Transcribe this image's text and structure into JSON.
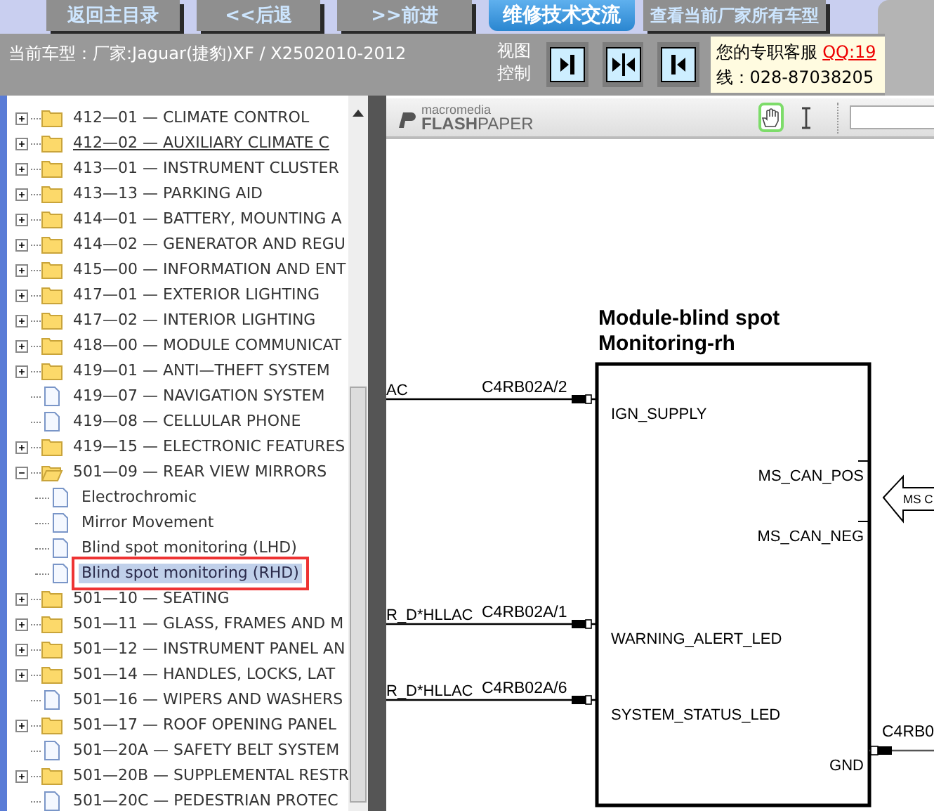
{
  "top_nav": {
    "buttons": [
      {
        "label": "返回主目录",
        "kind": "gray"
      },
      {
        "label": "<<后退",
        "kind": "gray"
      },
      {
        "label": ">>前进",
        "kind": "gray"
      },
      {
        "label": "维修技术交流",
        "kind": "blue"
      },
      {
        "label": "查看当前厂家所有车型",
        "kind": "gray"
      }
    ]
  },
  "model_bar": {
    "current_model": "当前车型：厂家:Jaguar(捷豹)XF / X2502010-2012",
    "view_control_label": "视图控制",
    "view_buttons": [
      {
        "kind": "expand-right"
      },
      {
        "kind": "split"
      },
      {
        "kind": "expand-left"
      }
    ],
    "support": {
      "label": "您的专职客服",
      "qq": "QQ:19",
      "phone": "线：028-87038205"
    }
  },
  "tree": {
    "items": [
      {
        "label": "412—01 — CLIMATE CONTROL",
        "kind": "folder",
        "expanded": false,
        "hovered": false
      },
      {
        "label": "412—02 — AUXILIARY CLIMATE C",
        "kind": "folder",
        "expanded": false,
        "hovered": true
      },
      {
        "label": "413—01 — INSTRUMENT CLUSTER",
        "kind": "folder",
        "expanded": false,
        "hovered": false
      },
      {
        "label": "413—13 — PARKING AID",
        "kind": "folder",
        "expanded": false,
        "hovered": false
      },
      {
        "label": "414—01 — BATTERY, MOUNTING A",
        "kind": "folder",
        "expanded": false,
        "hovered": false
      },
      {
        "label": "414—02 — GENERATOR AND REGU",
        "kind": "folder",
        "expanded": false,
        "hovered": false
      },
      {
        "label": "415—00 — INFORMATION AND ENT",
        "kind": "folder",
        "expanded": false,
        "hovered": false
      },
      {
        "label": "417—01 — EXTERIOR LIGHTING",
        "kind": "folder",
        "expanded": false,
        "hovered": false
      },
      {
        "label": "417—02 — INTERIOR LIGHTING",
        "kind": "folder",
        "expanded": false,
        "hovered": false
      },
      {
        "label": "418—00 — MODULE COMMUNICAT",
        "kind": "folder",
        "expanded": false,
        "hovered": false
      },
      {
        "label": "419—01 — ANTI—THEFT SYSTEM",
        "kind": "folder",
        "expanded": false,
        "hovered": false
      },
      {
        "label": "419—07 — NAVIGATION SYSTEM",
        "kind": "document",
        "hovered": false
      },
      {
        "label": "419—08 — CELLULAR PHONE",
        "kind": "document",
        "hovered": false
      },
      {
        "label": "419—15 — ELECTRONIC FEATURES",
        "kind": "folder",
        "expanded": false,
        "hovered": false
      },
      {
        "label": "501—09 — REAR VIEW MIRRORS",
        "kind": "folder",
        "expanded": true,
        "hovered": false,
        "children": [
          {
            "label": "Electrochromic",
            "kind": "document",
            "selected": false
          },
          {
            "label": "Mirror Movement",
            "kind": "document",
            "selected": false
          },
          {
            "label": "Blind spot monitoring (LHD)",
            "kind": "document",
            "selected": false
          },
          {
            "label": "Blind spot monitoring (RHD)",
            "kind": "document",
            "selected": true
          }
        ]
      },
      {
        "label": "501—10 — SEATING",
        "kind": "folder",
        "expanded": false,
        "hovered": false
      },
      {
        "label": "501—11 — GLASS, FRAMES AND M",
        "kind": "folder",
        "expanded": false,
        "hovered": false
      },
      {
        "label": "501—12 — INSTRUMENT PANEL AN",
        "kind": "folder",
        "expanded": false,
        "hovered": false
      },
      {
        "label": "501—14 — HANDLES, LOCKS, LAT",
        "kind": "folder",
        "expanded": false,
        "hovered": false
      },
      {
        "label": "501—16 — WIPERS AND WASHERS",
        "kind": "document",
        "hovered": false
      },
      {
        "label": "501—17 — ROOF OPENING PANEL",
        "kind": "folder",
        "expanded": false,
        "hovered": false
      },
      {
        "label": "501—20A — SAFETY BELT SYSTEM",
        "kind": "document",
        "hovered": false
      },
      {
        "label": "501—20B — SUPPLEMENTAL RESTR",
        "kind": "folder",
        "expanded": false,
        "hovered": false
      },
      {
        "label": "501—20C — PEDESTRIAN PROTEC",
        "kind": "document",
        "hovered": false
      }
    ]
  },
  "viewer": {
    "logo_top": "macromedia",
    "logo_bottom": "**FLASH**PAPER",
    "tools": [
      {
        "kind": "hand",
        "selected": true
      },
      {
        "kind": "text-select",
        "selected": false
      }
    ],
    "diagram": {
      "title": [
        "Module-blind spot",
        "Monitoring-rh"
      ],
      "pins": [
        {
          "kind": "left",
          "name": "IGN_SUPPLY",
          "connector": "C4RB02A/2",
          "wire": "AC"
        },
        {
          "kind": "right",
          "name": "MS_CAN_POS"
        },
        {
          "kind": "right",
          "name": "MS_CAN_NEG"
        },
        {
          "kind": "left",
          "name": "WARNING_ALERT_LED",
          "connector": "C4RB02A/1",
          "wire": "R_D*HLLAC"
        },
        {
          "kind": "left",
          "name": "SYSTEM_STATUS_LED",
          "connector": "C4RB02A/6",
          "wire": "R_D*HLLAC"
        },
        {
          "kind": "right",
          "name": "GND",
          "connector": "C4RB0"
        }
      ],
      "bus_arrow": "MS C"
    }
  }
}
